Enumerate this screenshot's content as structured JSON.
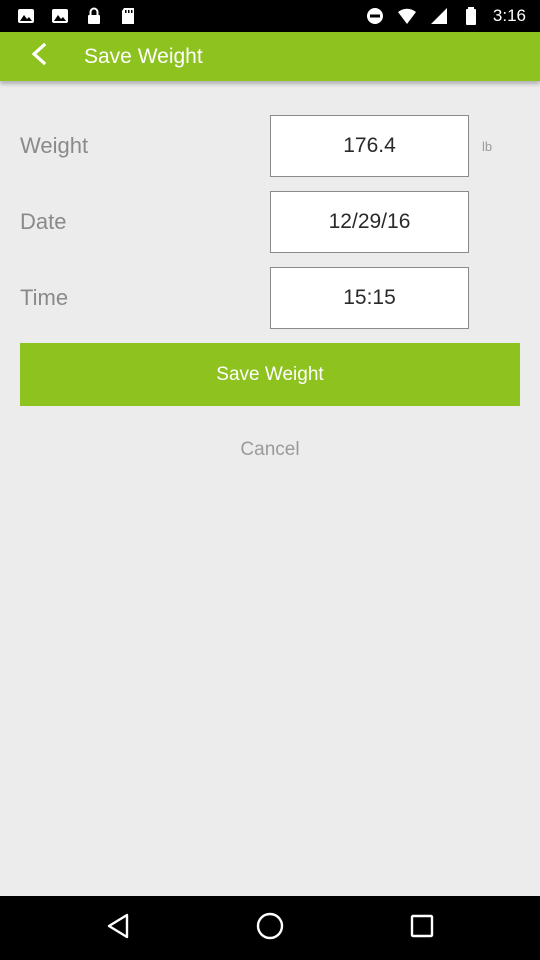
{
  "status_bar": {
    "time": "3:16",
    "left_icons": [
      "image-icon",
      "photo-icon",
      "lock-icon",
      "sd-card-icon"
    ],
    "right_icons": [
      "do-not-disturb-icon",
      "wifi-icon",
      "signal-icon",
      "battery-icon"
    ]
  },
  "app_bar": {
    "title": "Save Weight",
    "background": "#8dc21f",
    "back_icon": "back-arrow-icon"
  },
  "form": {
    "weight": {
      "label": "Weight",
      "value": "176.4",
      "unit": "lb"
    },
    "date": {
      "label": "Date",
      "value": "12/29/16"
    },
    "time": {
      "label": "Time",
      "value": "15:15"
    }
  },
  "actions": {
    "save_label": "Save Weight",
    "cancel_label": "Cancel"
  },
  "nav_bar": {
    "buttons": [
      "back-triangle-icon",
      "home-circle-icon",
      "recents-square-icon"
    ]
  }
}
